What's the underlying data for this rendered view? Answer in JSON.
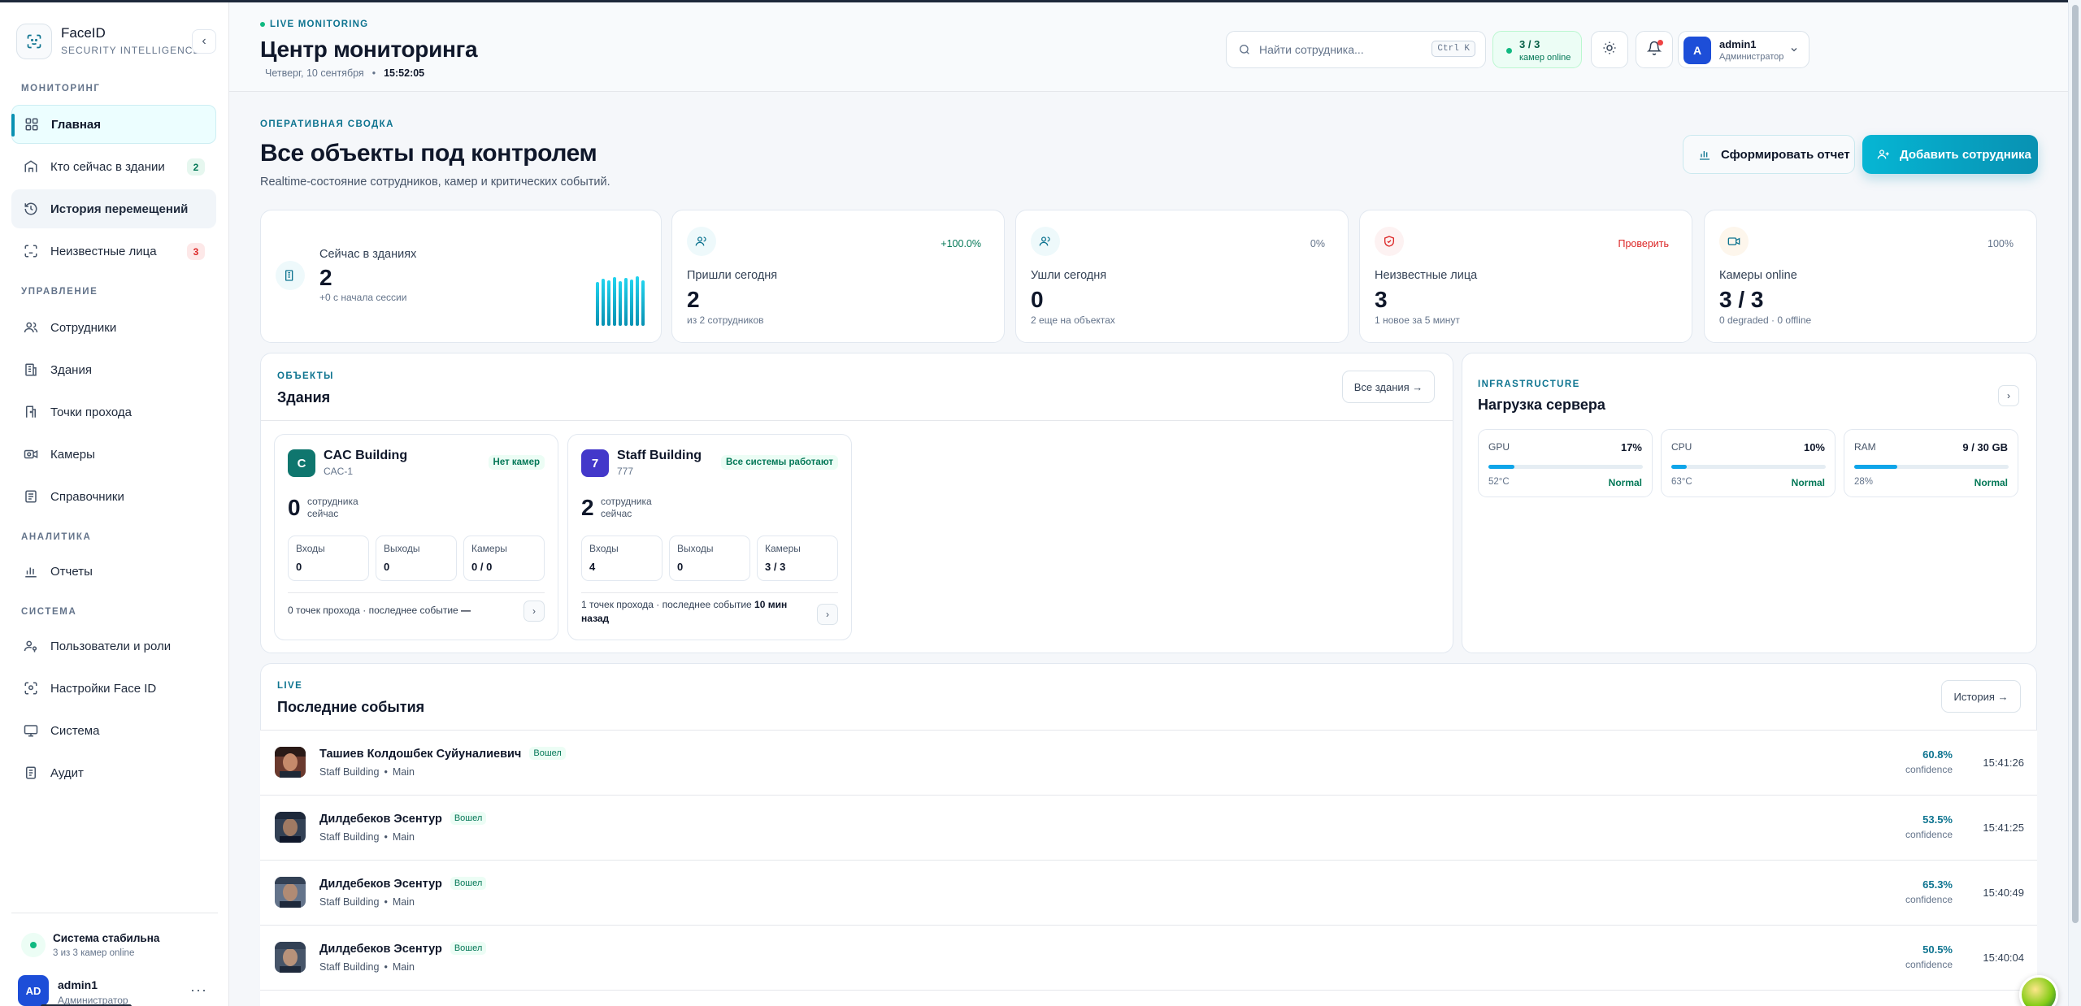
{
  "sidebar": {
    "brand_name": "FaceID",
    "brand_sub": "SECURITY INTELLIGENCE",
    "sections": {
      "monitoring": "МОНИТОРИНГ",
      "management": "УПРАВЛЕНИЕ",
      "analytics": "АНАЛИТИКА",
      "system": "СИСТЕМА"
    },
    "items": [
      {
        "label": "Главная",
        "icon": "grid-icon"
      },
      {
        "label": "Кто сейчас в здании",
        "icon": "building-icon",
        "badge": "2"
      },
      {
        "label": "История перемещений",
        "icon": "history-icon"
      },
      {
        "label": "Неизвестные лица",
        "icon": "unknown-face-icon",
        "badge": "3"
      },
      {
        "label": "Сотрудники",
        "icon": "users-icon"
      },
      {
        "label": "Здания",
        "icon": "office-icon"
      },
      {
        "label": "Точки прохода",
        "icon": "door-icon"
      },
      {
        "label": "Камеры",
        "icon": "camera-icon"
      },
      {
        "label": "Справочники",
        "icon": "book-icon"
      },
      {
        "label": "Отчеты",
        "icon": "chart-icon"
      },
      {
        "label": "Пользователи и роли",
        "icon": "user-key-icon"
      },
      {
        "label": "Настройки Face ID",
        "icon": "face-scan-icon"
      },
      {
        "label": "Система",
        "icon": "monitor-icon"
      },
      {
        "label": "Аудит",
        "icon": "clipboard-icon"
      }
    ],
    "status_title": "Система стабильна",
    "status_sub": "3 из 3 камер online",
    "user_initials": "AD",
    "user_name": "admin1",
    "user_role": "Администратор",
    "more": "···"
  },
  "header": {
    "live_label": "LIVE MONITORING",
    "title": "Центр мониторинга",
    "date": "Четверг, 10 сентября",
    "bullet": "•",
    "time": "15:52:05",
    "search_placeholder": "Найти сотрудника...",
    "search_kbd": "Ctrl K",
    "cams_value": "3 / 3",
    "cams_label": "камер online",
    "user_initial": "A",
    "user_name": "admin1",
    "user_role": "Администратор"
  },
  "hero": {
    "eyebrow": "ОПЕРАТИВНАЯ СВОДКА",
    "title": "Все объекты под контролем",
    "subtitle": "Realtime-состояние сотрудников, камер и критических событий.",
    "report_button": "Сформировать отчет",
    "add_button": "Добавить сотрудника"
  },
  "stats": [
    {
      "label": "Сейчас в зданиях",
      "value": "2",
      "sub": "+0 с начала сессии",
      "tag": ""
    },
    {
      "label": "Пришли сегодня",
      "value": "2",
      "sub": "из 2 сотрудников",
      "tag": "+100.0%"
    },
    {
      "label": "Ушли сегодня",
      "value": "0",
      "sub": "2 еще на объектах",
      "tag": "0%"
    },
    {
      "label": "Неизвестные лица",
      "value": "3",
      "sub": "1 новое за 5 минут",
      "tag": "Проверить"
    },
    {
      "label": "Камеры online",
      "value": "3 / 3",
      "sub": "0 degraded · 0 offline",
      "tag": "100%"
    }
  ],
  "buildings_panel": {
    "eyebrow": "ОБЪЕКТЫ",
    "title": "Здания",
    "all_button": "Все здания →",
    "buildings": [
      {
        "letter": "C",
        "name": "CAC Building",
        "code": "CAC-1",
        "status": "Нет камер",
        "count": "0",
        "count_label": "сотрудника сейчас",
        "entries_label": "Входы",
        "entries": "0",
        "exits_label": "Выходы",
        "exits": "0",
        "cams_label": "Камеры",
        "cams": "0 / 0",
        "footer": "0 точек прохода · последнее событие",
        "footer_bold": "—"
      },
      {
        "letter": "7",
        "name": "Staff Building",
        "code": "777",
        "status": "Все системы работают",
        "count": "2",
        "count_label": "сотрудника сейчас",
        "entries_label": "Входы",
        "entries": "4",
        "exits_label": "Выходы",
        "exits": "0",
        "cams_label": "Камеры",
        "cams": "3 / 3",
        "footer": "1 точек прохода · последнее событие",
        "footer_bold": "10 мин назад"
      }
    ]
  },
  "server_panel": {
    "eyebrow": "INFRASTRUCTURE",
    "title": "Нагрузка сервера",
    "metrics": [
      {
        "name": "GPU",
        "value": "17%",
        "level": 0.17,
        "temp": "52°C",
        "status": "Normal"
      },
      {
        "name": "CPU",
        "value": "10%",
        "level": 0.1,
        "temp": "63°C",
        "status": "Normal"
      },
      {
        "name": "RAM",
        "value": "9 / 30 GB",
        "level": 0.28,
        "temp": "28%",
        "status": "Normal"
      }
    ]
  },
  "events_panel": {
    "eyebrow": "LIVE",
    "title": "Последние события",
    "history_button": "История →",
    "events": [
      {
        "name": "Ташиев Колдошбек Суйуналиевич",
        "status": "Вошел",
        "building": "Staff Building",
        "point": "Main",
        "confidence": "60.8%",
        "confidence_label": "confidence",
        "time": "15:41:26"
      },
      {
        "name": "Дилдебеков Эсентур",
        "status": "Вошел",
        "building": "Staff Building",
        "point": "Main",
        "confidence": "53.5%",
        "confidence_label": "confidence",
        "time": "15:41:25"
      },
      {
        "name": "Дилдебеков Эсентур",
        "status": "Вошел",
        "building": "Staff Building",
        "point": "Main",
        "confidence": "65.3%",
        "confidence_label": "confidence",
        "time": "15:40:49"
      },
      {
        "name": "Дилдебеков Эсентур",
        "status": "Вошел",
        "building": "Staff Building",
        "point": "Main",
        "confidence": "50.5%",
        "confidence_label": "confidence",
        "time": "15:40:04"
      }
    ]
  },
  "colors": {
    "accent": "#0891b2",
    "success": "#10b981",
    "danger": "#ef4444",
    "brand_dark": "#1d4ed8"
  }
}
